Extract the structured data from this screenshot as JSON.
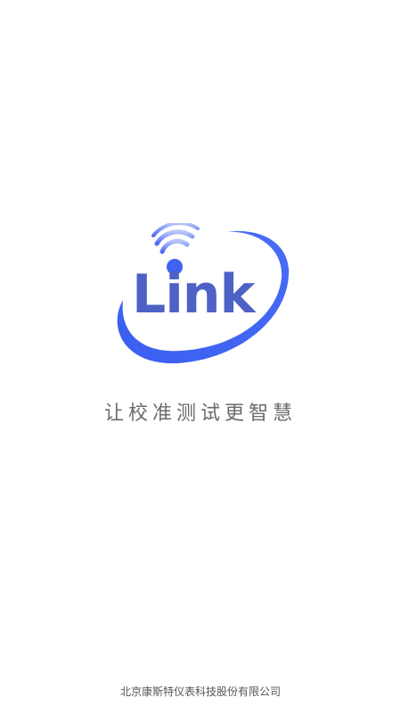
{
  "brand": {
    "logo_text": "Link",
    "primary_color": "#3f63f0",
    "text_color": "#4d62c4",
    "icon": "wifi-signal-icon"
  },
  "splash": {
    "slogan": "让校准测试更智慧",
    "company": "北京康斯特仪表科技股份有限公司"
  }
}
